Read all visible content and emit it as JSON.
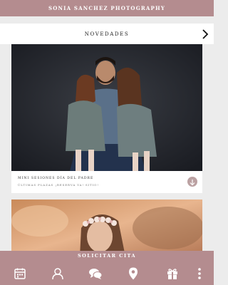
{
  "header": {
    "title": "SONIA SANCHEZ PHOTOGRAPHY"
  },
  "section": {
    "title": "NOVEDADES"
  },
  "cards": [
    {
      "title": "MINI SESIONES DÍA DEL PADRE",
      "subtitle": "ÚLTIMAS PLAZAS ¡RESERVA YA! SITIO!",
      "badge_icon": "share-icon"
    },
    {
      "image": "girl-with-flower-crown-photo"
    }
  ],
  "cta": {
    "label": "SOLICITAR CITA"
  },
  "nav": [
    {
      "icon": "calendar-icon"
    },
    {
      "icon": "user-icon"
    },
    {
      "icon": "chat-icon"
    },
    {
      "icon": "location-pin-icon"
    },
    {
      "icon": "gift-icon"
    },
    {
      "icon": "more-vertical-icon"
    }
  ],
  "colors": {
    "accent": "#b48c8f",
    "background": "#ececec",
    "card": "#ffffff"
  }
}
